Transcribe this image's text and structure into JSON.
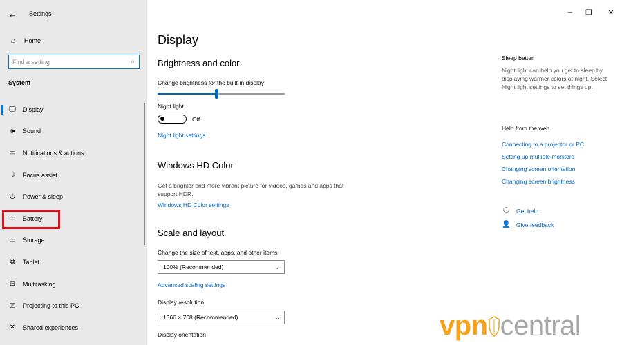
{
  "window": {
    "title": "Settings",
    "back_glyph": "←",
    "minimize_glyph": "–",
    "restore_glyph": "❐",
    "close_glyph": "✕"
  },
  "sidebar": {
    "home": {
      "icon": "home-icon",
      "glyph": "⌂",
      "label": "Home"
    },
    "search": {
      "placeholder": "Find a setting",
      "icon": "search-icon",
      "glyph": "⌕"
    },
    "group_label": "System",
    "items": [
      {
        "label": "Display",
        "icon": "monitor-icon",
        "glyph": "🖵",
        "active": true
      },
      {
        "label": "Sound",
        "icon": "speaker-icon",
        "glyph": "🕪",
        "active": false
      },
      {
        "label": "Notifications & actions",
        "icon": "notification-icon",
        "glyph": "▭",
        "active": false
      },
      {
        "label": "Focus assist",
        "icon": "moon-icon",
        "glyph": "☽",
        "active": false
      },
      {
        "label": "Power & sleep",
        "icon": "power-icon",
        "glyph": "⏻",
        "active": false
      },
      {
        "label": "Battery",
        "icon": "battery-icon",
        "glyph": "▭",
        "active": false
      },
      {
        "label": "Storage",
        "icon": "storage-icon",
        "glyph": "▭",
        "active": false
      },
      {
        "label": "Tablet",
        "icon": "tablet-icon",
        "glyph": "⧉",
        "active": false
      },
      {
        "label": "Multitasking",
        "icon": "multitasking-icon",
        "glyph": "⊟",
        "active": false
      },
      {
        "label": "Projecting to this PC",
        "icon": "projecting-icon",
        "glyph": "⎚",
        "active": false
      },
      {
        "label": "Shared experiences",
        "icon": "shared-experiences-icon",
        "glyph": "✕",
        "active": false
      }
    ],
    "highlighted_item": "Battery"
  },
  "main": {
    "title": "Display",
    "brightness": {
      "heading": "Brightness and color",
      "slider_label": "Change brightness for the built-in display",
      "slider_level_percent": 45,
      "night_light_label": "Night light",
      "night_light_state": "Off",
      "night_light_link": "Night light settings"
    },
    "hd_color": {
      "heading": "Windows HD Color",
      "description": "Get a brighter and more vibrant picture for videos, games and apps that support HDR.",
      "link": "Windows HD Color settings"
    },
    "scale": {
      "heading": "Scale and layout",
      "size_label": "Change the size of text, apps, and other items",
      "size_value": "100% (Recommended)",
      "advanced_link": "Advanced scaling settings",
      "resolution_label": "Display resolution",
      "resolution_value": "1366 × 768 (Recommended)",
      "orientation_label": "Display orientation"
    },
    "dropdown_glyph": "⌄"
  },
  "right": {
    "sleep_heading": "Sleep better",
    "sleep_text": "Night light can help you get to sleep by displaying warmer colors at night. Select Night light settings to set things up.",
    "help_heading": "Help from the web",
    "help_links": [
      "Connecting to a projector or PC",
      "Setting up multiple monitors",
      "Changing screen orientation",
      "Changing screen brightness"
    ],
    "get_help": {
      "label": "Get help",
      "icon": "get-help-icon",
      "glyph": "🗨"
    },
    "give_feedback": {
      "label": "Give feedback",
      "icon": "feedback-icon",
      "glyph": "👤"
    }
  },
  "watermark": {
    "part1": "vpn",
    "part2": "central"
  },
  "colors": {
    "accent": "#0067c0",
    "highlight_box": "#e0101b",
    "watermark_orange": "#f5a11c",
    "watermark_gray": "#a8a8a8",
    "sidebar_bg": "#e9e9e9"
  }
}
